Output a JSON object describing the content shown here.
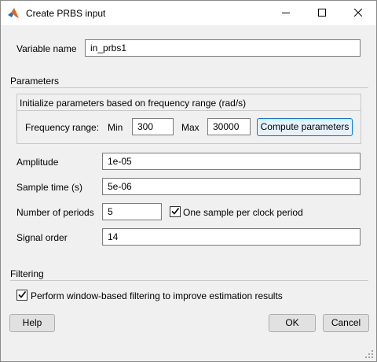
{
  "window": {
    "title": "Create PRBS input"
  },
  "fields": {
    "variable_name_label": "Variable name",
    "variable_name_value": "in_prbs1"
  },
  "parameters": {
    "section_title": "Parameters",
    "init_group_title": "Initialize parameters based on frequency range (rad/s)",
    "frequency_range_label": "Frequency range:",
    "min_label": "Min",
    "min_value": "300",
    "max_label": "Max",
    "max_value": "30000",
    "compute_button": "Compute parameters",
    "amplitude_label": "Amplitude",
    "amplitude_value": "1e-05",
    "sample_time_label": "Sample time (s)",
    "sample_time_value": "5e-06",
    "num_periods_label": "Number of periods",
    "num_periods_value": "5",
    "one_sample_label": "One sample per clock period",
    "one_sample_checked": true,
    "signal_order_label": "Signal order",
    "signal_order_value": "14"
  },
  "filtering": {
    "section_title": "Filtering",
    "window_filter_label": "Perform window-based filtering to improve estimation results",
    "window_filter_checked": true
  },
  "buttons": {
    "help": "Help",
    "ok": "OK",
    "cancel": "Cancel"
  },
  "icons": {
    "app": "matlab-logo-icon",
    "minimize": "minimize-icon",
    "maximize": "maximize-icon",
    "close": "close-icon",
    "check": "checkmark-icon"
  }
}
